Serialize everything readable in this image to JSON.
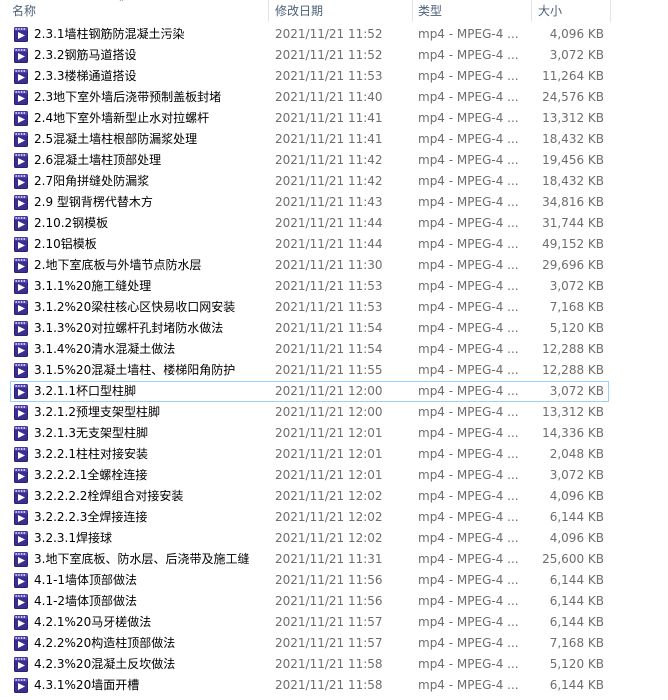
{
  "columns": {
    "name": "名称",
    "date": "修改日期",
    "type": "类型",
    "size": "大小"
  },
  "selected_index": 17,
  "rows": [
    {
      "name": "2.3.1墙柱钢筋防混凝土污染",
      "date": "2021/11/21 11:52",
      "type": "mp4 - MPEG-4 ...",
      "size": "4,096 KB"
    },
    {
      "name": "2.3.2钢筋马道搭设",
      "date": "2021/11/21 11:52",
      "type": "mp4 - MPEG-4 ...",
      "size": "3,072 KB"
    },
    {
      "name": "2.3.3楼梯通道搭设",
      "date": "2021/11/21 11:53",
      "type": "mp4 - MPEG-4 ...",
      "size": "11,264 KB"
    },
    {
      "name": "2.3地下室外墙后浇带预制盖板封堵",
      "date": "2021/11/21 11:40",
      "type": "mp4 - MPEG-4 ...",
      "size": "24,576 KB"
    },
    {
      "name": "2.4地下室外墙新型止水对拉螺杆",
      "date": "2021/11/21 11:41",
      "type": "mp4 - MPEG-4 ...",
      "size": "13,312 KB"
    },
    {
      "name": "2.5混凝土墙柱根部防漏浆处理",
      "date": "2021/11/21 11:41",
      "type": "mp4 - MPEG-4 ...",
      "size": "18,432 KB"
    },
    {
      "name": "2.6混凝土墙柱顶部处理",
      "date": "2021/11/21 11:42",
      "type": "mp4 - MPEG-4 ...",
      "size": "19,456 KB"
    },
    {
      "name": "2.7阳角拼缝处防漏浆",
      "date": "2021/11/21 11:42",
      "type": "mp4 - MPEG-4 ...",
      "size": "18,432 KB"
    },
    {
      "name": "2.9 型钢背楞代替木方",
      "date": "2021/11/21 11:43",
      "type": "mp4 - MPEG-4 ...",
      "size": "34,816 KB"
    },
    {
      "name": "2.10.2钢模板",
      "date": "2021/11/21 11:44",
      "type": "mp4 - MPEG-4 ...",
      "size": "31,744 KB"
    },
    {
      "name": "2.10铝模板",
      "date": "2021/11/21 11:44",
      "type": "mp4 - MPEG-4 ...",
      "size": "49,152 KB"
    },
    {
      "name": "2.地下室底板与外墙节点防水层",
      "date": "2021/11/21 11:30",
      "type": "mp4 - MPEG-4 ...",
      "size": "29,696 KB"
    },
    {
      "name": "3.1.1%20施工缝处理",
      "date": "2021/11/21 11:53",
      "type": "mp4 - MPEG-4 ...",
      "size": "3,072 KB"
    },
    {
      "name": "3.1.2%20梁柱核心区快易收口网安装",
      "date": "2021/11/21 11:53",
      "type": "mp4 - MPEG-4 ...",
      "size": "7,168 KB"
    },
    {
      "name": "3.1.3%20对拉螺杆孔封堵防水做法",
      "date": "2021/11/21 11:54",
      "type": "mp4 - MPEG-4 ...",
      "size": "5,120 KB"
    },
    {
      "name": "3.1.4%20清水混凝土做法",
      "date": "2021/11/21 11:54",
      "type": "mp4 - MPEG-4 ...",
      "size": "12,288 KB"
    },
    {
      "name": "3.1.5%20混凝土墙柱、楼梯阳角防护",
      "date": "2021/11/21 11:55",
      "type": "mp4 - MPEG-4 ...",
      "size": "12,288 KB"
    },
    {
      "name": "3.2.1.1杯口型柱脚",
      "date": "2021/11/21 12:00",
      "type": "mp4 - MPEG-4 ...",
      "size": "3,072 KB"
    },
    {
      "name": "3.2.1.2预埋支架型柱脚",
      "date": "2021/11/21 12:00",
      "type": "mp4 - MPEG-4 ...",
      "size": "13,312 KB"
    },
    {
      "name": "3.2.1.3无支架型柱脚",
      "date": "2021/11/21 12:01",
      "type": "mp4 - MPEG-4 ...",
      "size": "14,336 KB"
    },
    {
      "name": "3.2.2.1柱柱对接安装",
      "date": "2021/11/21 12:01",
      "type": "mp4 - MPEG-4 ...",
      "size": "2,048 KB"
    },
    {
      "name": "3.2.2.2.1全螺栓连接",
      "date": "2021/11/21 12:01",
      "type": "mp4 - MPEG-4 ...",
      "size": "3,072 KB"
    },
    {
      "name": "3.2.2.2.2栓焊组合对接安装",
      "date": "2021/11/21 12:02",
      "type": "mp4 - MPEG-4 ...",
      "size": "4,096 KB"
    },
    {
      "name": "3.2.2.2.3全焊接连接",
      "date": "2021/11/21 12:02",
      "type": "mp4 - MPEG-4 ...",
      "size": "6,144 KB"
    },
    {
      "name": "3.2.3.1焊接球",
      "date": "2021/11/21 12:02",
      "type": "mp4 - MPEG-4 ...",
      "size": "4,096 KB"
    },
    {
      "name": "3.地下室底板、防水层、后浇带及施工缝",
      "date": "2021/11/21 11:31",
      "type": "mp4 - MPEG-4 ...",
      "size": "25,600 KB"
    },
    {
      "name": "4.1-1墙体顶部做法",
      "date": "2021/11/21 11:56",
      "type": "mp4 - MPEG-4 ...",
      "size": "6,144 KB"
    },
    {
      "name": "4.1-2墙体顶部做法",
      "date": "2021/11/21 11:56",
      "type": "mp4 - MPEG-4 ...",
      "size": "6,144 KB"
    },
    {
      "name": "4.2.1%20马牙槎做法",
      "date": "2021/11/21 11:57",
      "type": "mp4 - MPEG-4 ...",
      "size": "6,144 KB"
    },
    {
      "name": "4.2.2%20构造柱顶部做法",
      "date": "2021/11/21 11:57",
      "type": "mp4 - MPEG-4 ...",
      "size": "7,168 KB"
    },
    {
      "name": "4.2.3%20混凝土反坎做法",
      "date": "2021/11/21 11:58",
      "type": "mp4 - MPEG-4 ...",
      "size": "5,120 KB"
    },
    {
      "name": "4.3.1%20墙面开槽",
      "date": "2021/11/21 11:58",
      "type": "mp4 - MPEG-4 ...",
      "size": "6,144 KB"
    }
  ]
}
